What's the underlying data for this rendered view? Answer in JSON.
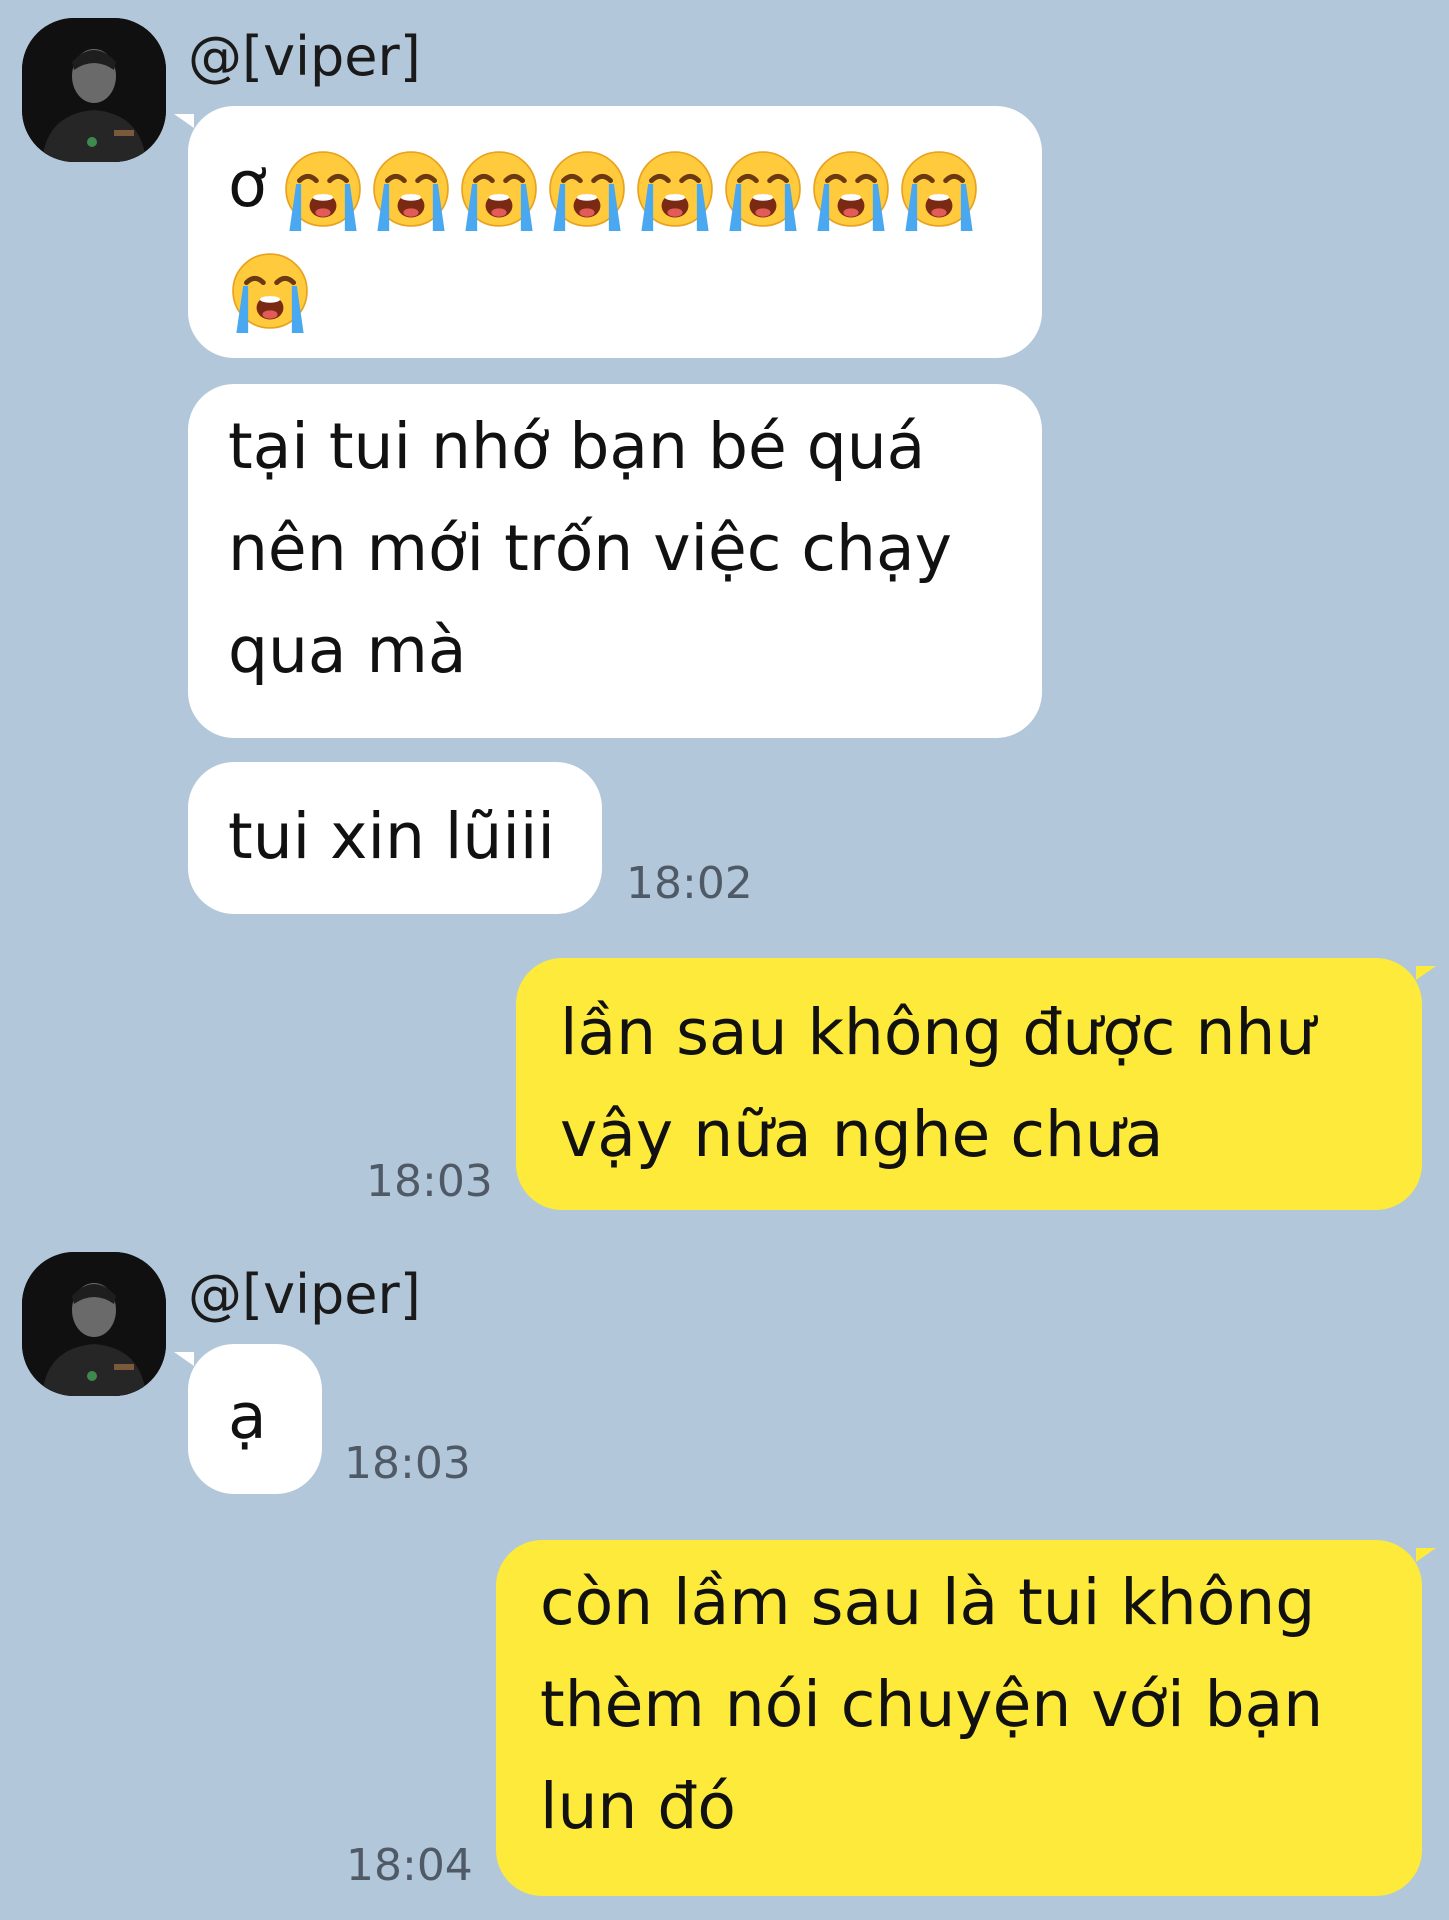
{
  "colors": {
    "background": "#b2c7da",
    "incoming_bubble": "#ffffff",
    "outgoing_bubble": "#fdea3b"
  },
  "messages": [
    {
      "sender": "@[viper]",
      "side": "incoming",
      "bubbles": [
        {
          "prefix": "ơ",
          "emoji": "loudly-crying-face-icon",
          "emoji_count": 9
        },
        {
          "lines": [
            "tại tui nhớ bạn bé quá",
            "nên mới trốn việc chạy",
            "qua mà"
          ]
        },
        {
          "lines": [
            "tui xin lũiii"
          ],
          "time": "18:02"
        }
      ]
    },
    {
      "side": "outgoing",
      "bubbles": [
        {
          "lines": [
            "lần sau không được như",
            "vậy nữa nghe chưa"
          ],
          "time": "18:03"
        }
      ]
    },
    {
      "sender": "@[viper]",
      "side": "incoming",
      "bubbles": [
        {
          "lines": [
            "ạ"
          ],
          "time": "18:03"
        }
      ]
    },
    {
      "side": "outgoing",
      "bubbles": [
        {
          "lines": [
            "còn lầm sau là tui không",
            "thèm nói chuyện với bạn",
            "lun đó"
          ],
          "time": "18:04"
        }
      ]
    }
  ]
}
